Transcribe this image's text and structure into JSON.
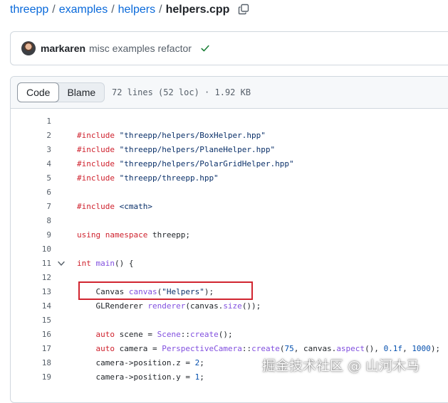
{
  "breadcrumb": {
    "repo": "threepp",
    "folder1": "examples",
    "folder2": "helpers",
    "file": "helpers.cpp",
    "sep": "/"
  },
  "commit": {
    "author": "markaren",
    "message": "misc examples refactor",
    "status_color": "#1a7f37"
  },
  "file_header": {
    "tabs": [
      "Code",
      "Blame"
    ],
    "active_tab": "Code",
    "meta": "72 lines (52 loc) · 1.92 KB"
  },
  "code": {
    "lines": [
      {
        "n": "1"
      },
      {
        "n": "2",
        "text": "#include \"threepp/helpers/BoxHelper.hpp\""
      },
      {
        "n": "3",
        "text": "#include \"threepp/helpers/PlaneHelper.hpp\""
      },
      {
        "n": "4",
        "text": "#include \"threepp/helpers/PolarGridHelper.hpp\""
      },
      {
        "n": "5",
        "text": "#include \"threepp/threepp.hpp\""
      },
      {
        "n": "6"
      },
      {
        "n": "7",
        "text": "#include <cmath>"
      },
      {
        "n": "8"
      },
      {
        "n": "9",
        "text": "using namespace threepp;"
      },
      {
        "n": "10"
      },
      {
        "n": "11",
        "text": "int main() {"
      },
      {
        "n": "12"
      },
      {
        "n": "13",
        "text": "    Canvas canvas(\"Helpers\");"
      },
      {
        "n": "14",
        "text": "    GLRenderer renderer(canvas.size());"
      },
      {
        "n": "15"
      },
      {
        "n": "16",
        "text": "    auto scene = Scene::create();"
      },
      {
        "n": "17",
        "text": "    auto camera = PerspectiveCamera::create(75, canvas.aspect(), 0.1f, 1000);"
      },
      {
        "n": "18",
        "text": "    camera->position.z = 2;"
      },
      {
        "n": "19",
        "text": "    camera->position.y = 1;"
      }
    ]
  },
  "watermark": "掘金技术社区 @ 山河木马"
}
